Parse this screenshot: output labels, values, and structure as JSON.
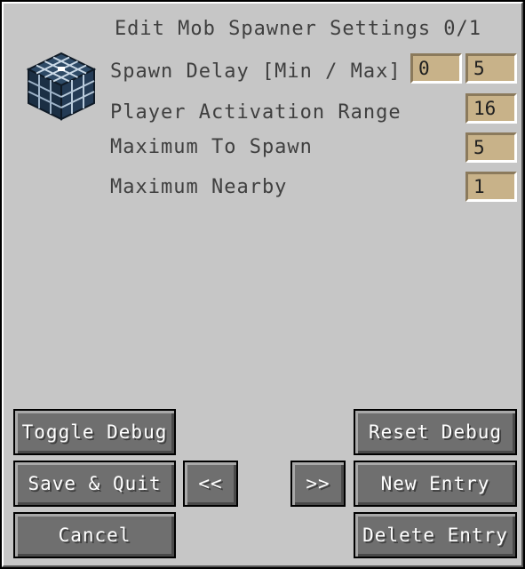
{
  "title": "Edit Mob Spawner Settings 0/1",
  "icon": "mob-spawner-block-icon",
  "settings": {
    "spawn_delay": {
      "label": "Spawn Delay [Min / Max]",
      "min": "0",
      "max": "5"
    },
    "player_activation_range": {
      "label": "Player Activation Range",
      "value": "16"
    },
    "maximum_to_spawn": {
      "label": "Maximum To Spawn",
      "value": "5"
    },
    "maximum_nearby": {
      "label": "Maximum Nearby",
      "value": "1"
    }
  },
  "buttons": {
    "toggle_debug": "Toggle Debug",
    "reset_debug": "Reset Debug",
    "save_quit": "Save & Quit",
    "prev": "<<",
    "next": ">>",
    "new_entry": "New Entry",
    "cancel": "Cancel",
    "delete_entry": "Delete Entry"
  },
  "colors": {
    "panel": "#c6c6c6",
    "button": "#6f6f6f",
    "field": "#c8b289",
    "label_text": "#3f3f3f"
  }
}
